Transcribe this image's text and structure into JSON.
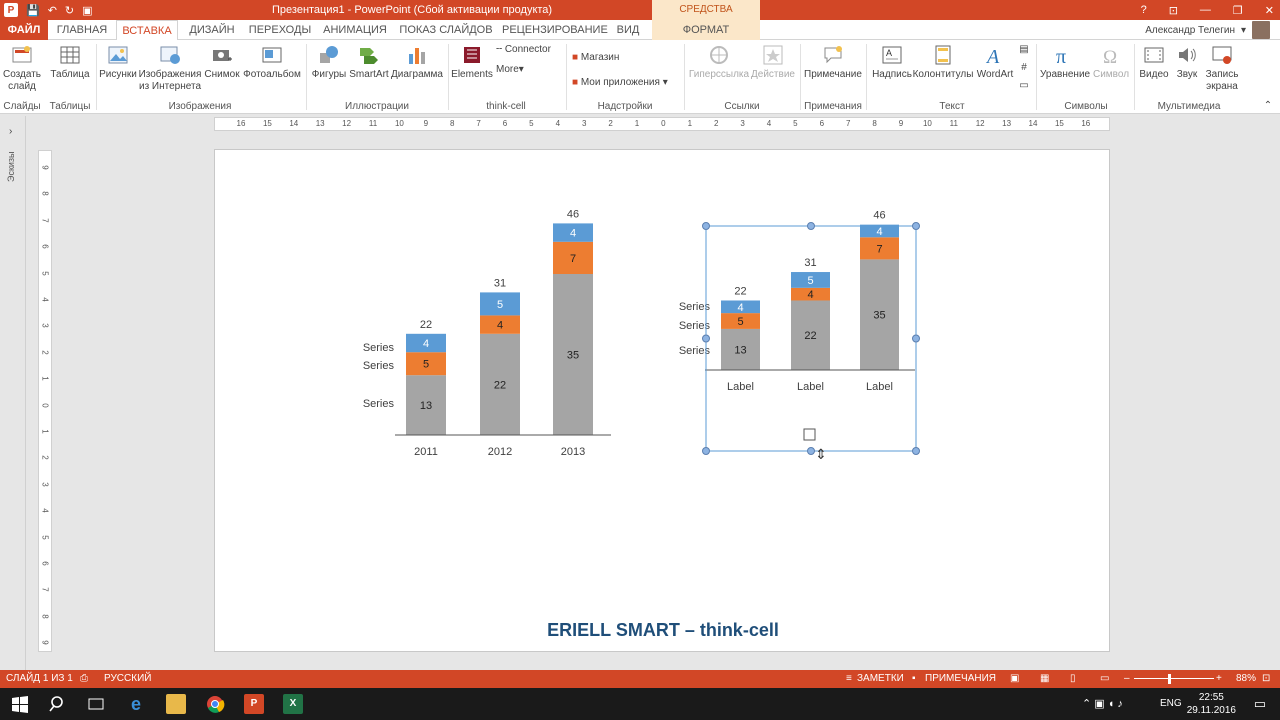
{
  "titlebar": {
    "title": "Презентация1 -  PowerPoint (Сбой активации продукта)",
    "context_tab": "СРЕДСТВА РИСОВАНИЯ",
    "help": "?",
    "min": "—",
    "restore": "❐",
    "close": "✕",
    "ribbon_toggle": "⊡"
  },
  "tabs": {
    "file": "ФАЙЛ",
    "home": "ГЛАВНАЯ",
    "insert": "ВСТАВКА",
    "design": "ДИЗАЙН",
    "transitions": "ПЕРЕХОДЫ",
    "animations": "АНИМАЦИЯ",
    "slideshow": "ПОКАЗ СЛАЙДОВ",
    "review": "РЕЦЕНЗИРОВАНИЕ",
    "view": "ВИД",
    "format": "ФОРМАТ"
  },
  "user": {
    "name": "Александр Телегин"
  },
  "ribbon": {
    "new_slide": "Создать слайд",
    "table": "Таблица",
    "pictures": "Рисунки",
    "online_pictures": "Изображения из Интернета",
    "screenshot": "Снимок",
    "photo_album": "Фотоальбом",
    "shapes": "Фигуры",
    "smartart": "SmartArt",
    "chart": "Диаграмма",
    "elements": "Elements",
    "connector": "Connector",
    "more": "More",
    "store": "Магазин",
    "my_apps": "Мои приложения",
    "hyperlink": "Гиперссылка",
    "action": "Действие",
    "comment": "Примечание",
    "textbox": "Надпись",
    "header_footer": "Колонтитулы",
    "wordart": "WordArt",
    "equation": "Уравнение",
    "symbol": "Символ",
    "video": "Видео",
    "audio": "Звук",
    "screen_recording": "Запись экрана"
  },
  "groups": {
    "slides": "Слайды",
    "tables": "Таблицы",
    "images": "Изображения",
    "illustrations": "Иллюстрации",
    "thinkcell": "think-cell",
    "addins": "Надстройки",
    "links": "Ссылки",
    "comments": "Примечания",
    "text": "Текст",
    "symbols": "Символы",
    "media": "Мультимедиа"
  },
  "sidebar": {
    "thumbnails": "Эскизы"
  },
  "hruler": {
    "ticks": [
      "16",
      "15",
      "14",
      "13",
      "12",
      "11",
      "10",
      "9",
      "8",
      "7",
      "6",
      "5",
      "4",
      "3",
      "2",
      "1",
      "0",
      "1",
      "2",
      "3",
      "4",
      "5",
      "6",
      "7",
      "8",
      "9",
      "10",
      "11",
      "12",
      "13",
      "14",
      "15",
      "16"
    ]
  },
  "vruler": {
    "ticks": [
      "9",
      "8",
      "7",
      "6",
      "5",
      "4",
      "3",
      "2",
      "1",
      "0",
      "1",
      "2",
      "3",
      "4",
      "5",
      "6",
      "7",
      "8",
      "9"
    ]
  },
  "slide": {
    "footer": "ERIELL SMART – think-cell"
  },
  "chart_data": [
    {
      "type": "bar",
      "stacked": true,
      "categories": [
        "2011",
        "2012",
        "2013"
      ],
      "series_labels": [
        "Series",
        "Series",
        "Series"
      ],
      "series": [
        {
          "values": [
            13,
            22,
            35
          ],
          "color": "#a5a5a5"
        },
        {
          "values": [
            5,
            4,
            7
          ],
          "color": "#ed7d31"
        },
        {
          "values": [
            4,
            5,
            4
          ],
          "color": "#5b9bd5"
        }
      ],
      "totals": [
        22,
        31,
        46
      ]
    },
    {
      "type": "bar",
      "stacked": true,
      "categories": [
        "Label",
        "Label",
        "Label"
      ],
      "series_labels": [
        "Series",
        "Series",
        "Series"
      ],
      "series": [
        {
          "values": [
            13,
            22,
            35
          ],
          "color": "#a5a5a5"
        },
        {
          "values": [
            5,
            4,
            7
          ],
          "color": "#ed7d31"
        },
        {
          "values": [
            4,
            5,
            4
          ],
          "color": "#5b9bd5"
        }
      ],
      "totals": [
        22,
        31,
        46
      ]
    }
  ],
  "status": {
    "slide": "СЛАЙД 1 ИЗ 1",
    "lang": "РУССКИЙ",
    "notes": "ЗАМЕТКИ",
    "comments": "ПРИМЕЧАНИЯ",
    "zoom": "88%"
  },
  "taskbar": {
    "time": "22:55",
    "date": "29.11.2016",
    "lang": "ENG"
  }
}
